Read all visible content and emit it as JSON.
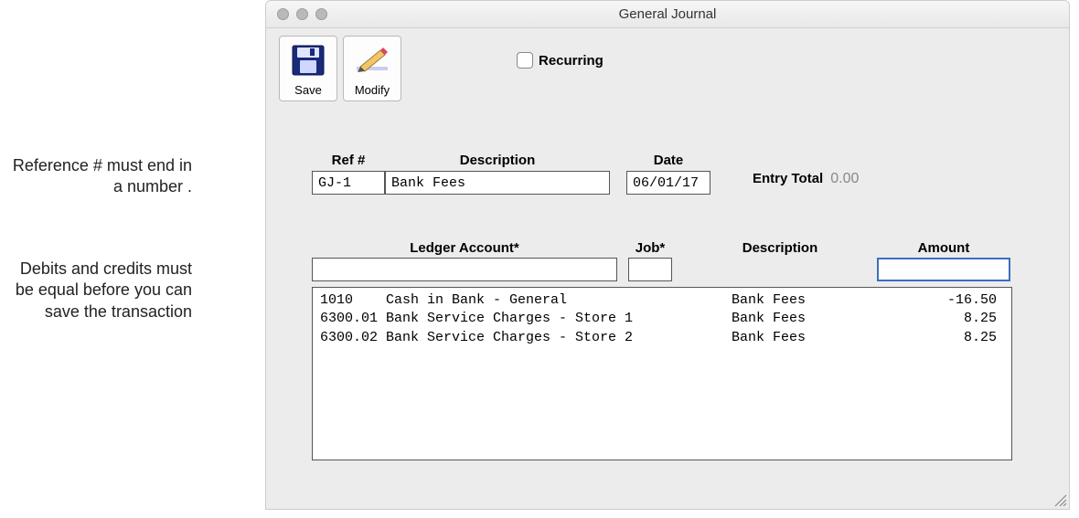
{
  "window": {
    "title": "General Journal"
  },
  "toolbar": {
    "save_label": "Save",
    "modify_label": "Modify",
    "recurring_label": "Recurring"
  },
  "annotations": {
    "ref_note": "Reference # must end in a number .",
    "balance_note": "Debits and credits must be equal before you can save the transaction"
  },
  "header": {
    "ref_label": "Ref #",
    "ref_value": "GJ-1",
    "desc_label": "Description",
    "desc_value": "Bank Fees",
    "date_label": "Date",
    "date_value": "06/01/17",
    "entry_total_label": "Entry Total",
    "entry_total_value": "0.00"
  },
  "grid": {
    "headers": {
      "ledger": "Ledger Account*",
      "job": "Job*",
      "description": "Description",
      "amount": "Amount"
    },
    "rows": [
      {
        "ledger": "1010    Cash in Bank - General",
        "job": "",
        "description": "Bank Fees",
        "amount": "-16.50"
      },
      {
        "ledger": "6300.01 Bank Service Charges - Store 1",
        "job": "",
        "description": "Bank Fees",
        "amount": "8.25"
      },
      {
        "ledger": "6300.02 Bank Service Charges - Store 2",
        "job": "",
        "description": "Bank Fees",
        "amount": "8.25"
      }
    ]
  }
}
